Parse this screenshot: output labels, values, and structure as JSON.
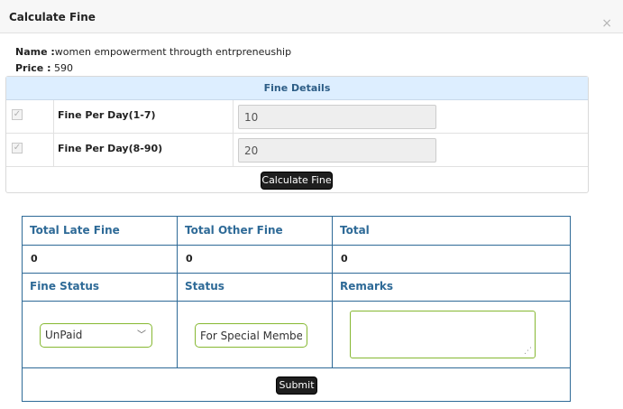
{
  "modal": {
    "title": "Calculate Fine",
    "close_symbol": "×"
  },
  "book": {
    "name_label": "Name :",
    "name_value": "women empowerment througth entrpreneuship",
    "price_label": "Price :",
    "price_value": "590"
  },
  "fine_details": {
    "heading": "Fine Details",
    "rows": [
      {
        "label": "Fine Per Day(1-7)",
        "value": "10",
        "checked": true
      },
      {
        "label": "Fine Per Day(8-90)",
        "value": "20",
        "checked": true
      }
    ],
    "calculate_label": "Calculate Fine"
  },
  "summary": {
    "headers": {
      "late": "Total Late Fine",
      "other": "Total Other Fine",
      "total": "Total"
    },
    "values": {
      "late": "0",
      "other": "0",
      "total": "0"
    },
    "status_headers": {
      "fine_status": "Fine Status",
      "status": "Status",
      "remarks": "Remarks"
    },
    "fine_status_selected": "UnPaid",
    "status_value": "For Special Member",
    "remarks_value": "",
    "submit_label": "Submit"
  },
  "colors": {
    "accent_blue": "#2e6a97",
    "header_bg": "#ddeeff",
    "input_border_green": "#86b832",
    "button_dark": "#1e1e1e"
  },
  "icons": {
    "checkbox": "check-icon",
    "close": "close-icon",
    "dropdown": "chevron-down-icon",
    "resize": "resize-grip-icon"
  }
}
